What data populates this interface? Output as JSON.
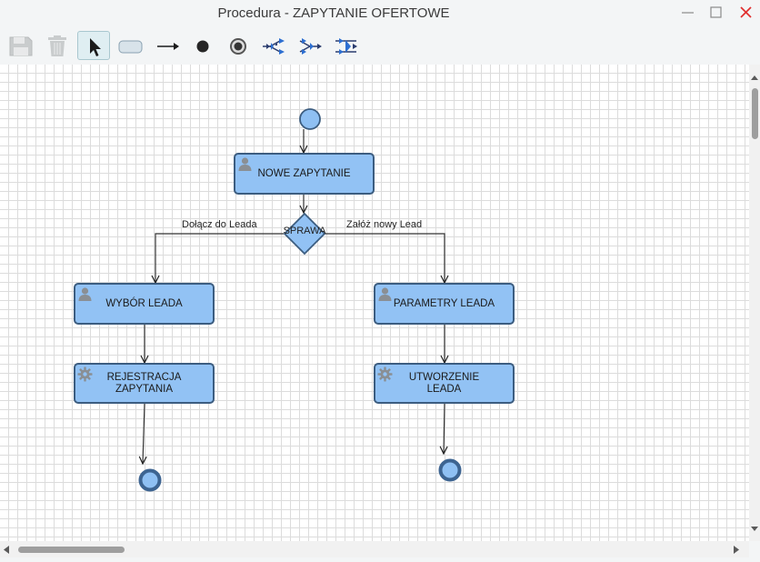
{
  "window": {
    "title": "Procedura - ZAPYTANIE OFERTOWE",
    "minimize_icon": "minimize-icon",
    "maximize_icon": "maximize-icon",
    "close_icon": "close-icon",
    "close_color": "#e03030"
  },
  "toolbar": {
    "tools": [
      {
        "name": "save",
        "icon": "floppy-disk-icon",
        "enabled": false
      },
      {
        "name": "delete",
        "icon": "trash-icon",
        "enabled": false
      },
      {
        "name": "select",
        "icon": "cursor-arrow-icon",
        "active": true
      },
      {
        "name": "task",
        "icon": "rounded-rect-icon"
      },
      {
        "name": "transition",
        "icon": "arrow-right-icon"
      },
      {
        "name": "start-event",
        "icon": "filled-circle-icon"
      },
      {
        "name": "end-event",
        "icon": "ring-circle-icon"
      },
      {
        "name": "fork",
        "icon": "fork-icon"
      },
      {
        "name": "join",
        "icon": "join-icon"
      },
      {
        "name": "merge",
        "icon": "merge-icon"
      }
    ]
  },
  "diagram": {
    "colors": {
      "node_fill": "#92c2f4",
      "node_border": "#3c5d80",
      "start_fill": "#8fc0f3",
      "end_ring": "#3d6491"
    },
    "nodes": {
      "nowe": {
        "label": "NOWE ZAPYTANIE",
        "icon": "user-icon"
      },
      "wybor": {
        "label": "WYBÓR LEADA",
        "icon": "user-icon"
      },
      "parametry": {
        "label": "PARAMETRY LEADA",
        "icon": "user-icon"
      },
      "rejestracja": {
        "label": "REJESTRACJA\nZAPYTANIA",
        "icon": "gear-icon"
      },
      "utworzenie": {
        "label": "UTWORZENIE\nLEADA",
        "icon": "gear-icon"
      }
    },
    "decision": {
      "label": "SPRAWA"
    },
    "edge_labels": {
      "left": "Dołącz do Leada",
      "right": "Załóż nowy Lead"
    }
  }
}
